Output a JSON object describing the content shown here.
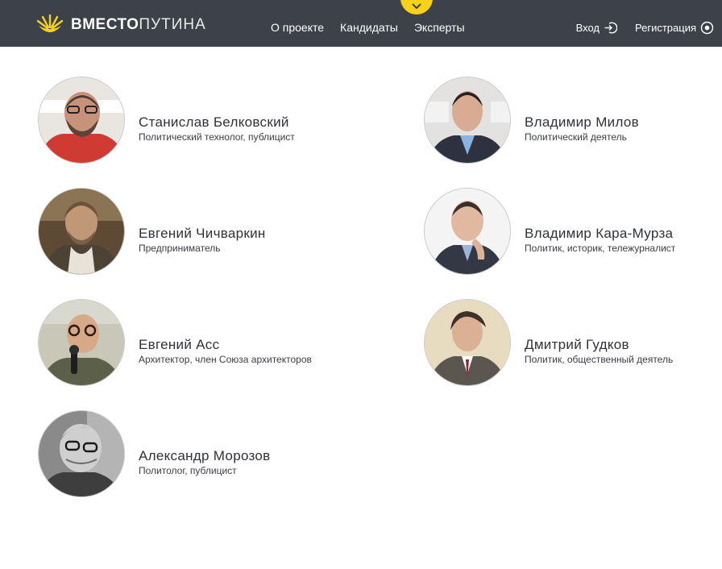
{
  "brand": {
    "name_bold": "ВМЕСТО",
    "name_light": "ПУТИНА",
    "accent_color": "#f7d21b",
    "header_color": "#3d424a"
  },
  "nav": {
    "items": [
      {
        "label": "О проекте"
      },
      {
        "label": "Кандидаты"
      },
      {
        "label": "Эксперты"
      }
    ]
  },
  "user_actions": {
    "login": {
      "label": "Вход",
      "icon": "login-icon"
    },
    "register": {
      "label": "Регистрация",
      "icon": "register-icon"
    }
  },
  "scroll_tab": {
    "icon": "chevron-down-icon"
  },
  "experts": [
    {
      "name": "Станислав Белковский",
      "role": "Политический технолог, публицист"
    },
    {
      "name": "Владимир Милов",
      "role": "Политический деятель"
    },
    {
      "name": "Евгений Чичваркин",
      "role": "Предприниматель"
    },
    {
      "name": "Владимир Кара-Мурза",
      "role": "Политик, историк, тележурналист"
    },
    {
      "name": "Евгений Асс",
      "role": "Архитектор, член Союза архитекторов"
    },
    {
      "name": "Дмитрий Гудков",
      "role": "Политик, общественный деятель"
    },
    {
      "name": "Александр Морозов",
      "role": "Политолог, публицист"
    }
  ]
}
